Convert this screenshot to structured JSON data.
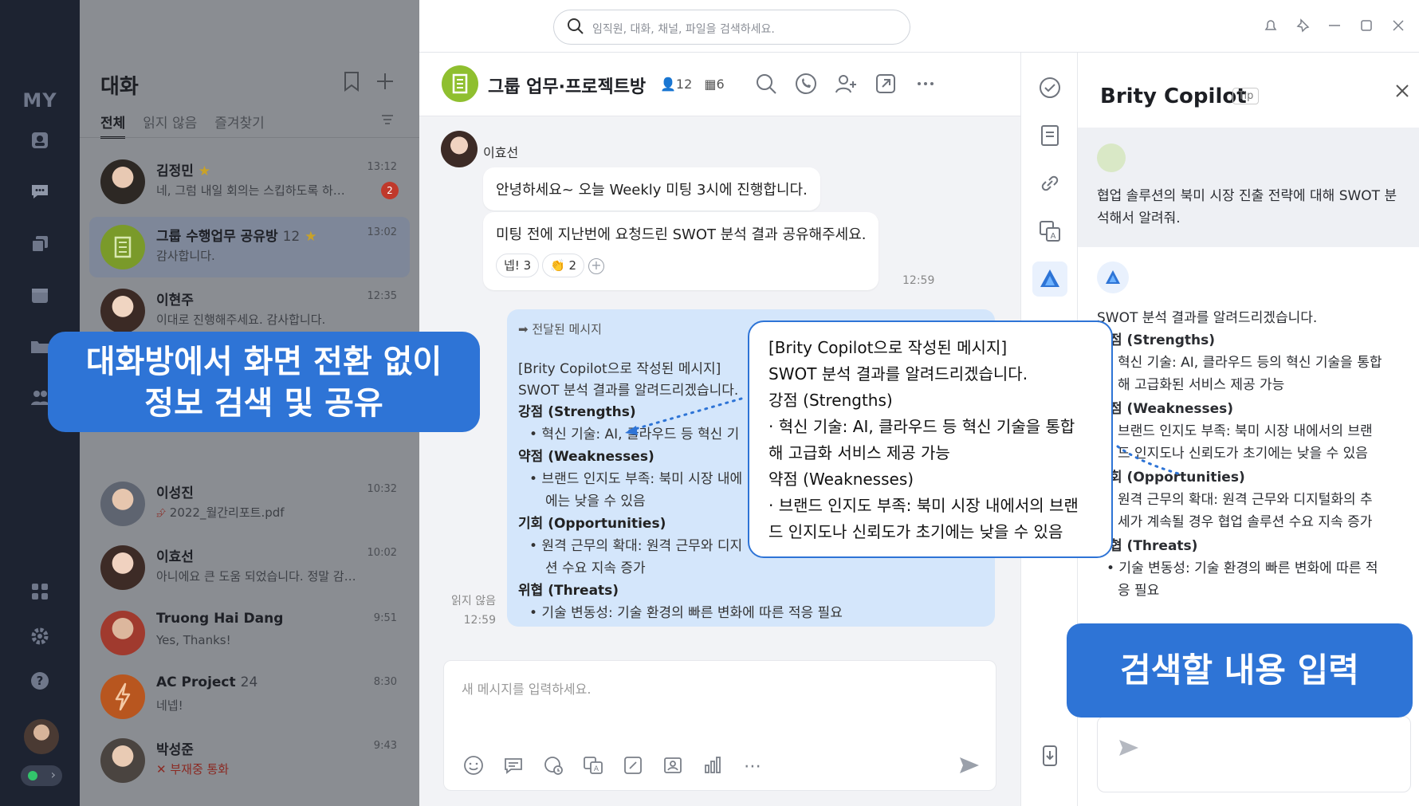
{
  "rail": {
    "my_label": "MY"
  },
  "convlist": {
    "title": "대화",
    "tabs": [
      "전체",
      "읽지 않음",
      "즐겨찾기"
    ],
    "items": [
      {
        "name": "김정민",
        "star": "★",
        "count": "",
        "preview": "네, 그럼 내일 회의는 스킵하도록 하…",
        "time": "13:12",
        "badge": "2"
      },
      {
        "name": "그룹 수행업무 공유방",
        "star": "★",
        "count": "12",
        "preview": "감사합니다.",
        "time": "13:02",
        "badge": ""
      },
      {
        "name": "이현주",
        "star": "",
        "count": "",
        "preview": "이대로 진행해주세요. 감사합니다.",
        "time": "12:35",
        "badge": ""
      },
      {
        "name": "이성진",
        "star": "",
        "count": "",
        "preview": "2022_월간리포트.pdf",
        "time": "10:32",
        "badge": ""
      },
      {
        "name": "이효선",
        "star": "",
        "count": "",
        "preview": "아니에요 큰 도움 되었습니다. 정말 감…",
        "time": "10:02",
        "badge": ""
      },
      {
        "name": "Truong Hai Dang",
        "star": "",
        "count": "",
        "preview": "Yes, Thanks!",
        "time": "9:51",
        "badge": ""
      },
      {
        "name": "AC Project",
        "star": "",
        "count": "24",
        "preview": "네넵!",
        "time": "8:30",
        "badge": ""
      },
      {
        "name": "박성준",
        "star": "",
        "count": "",
        "preview": "부재중 통화",
        "time": "9:43",
        "badge": ""
      }
    ]
  },
  "topbar": {
    "search_placeholder": "임직원, 대화, 채널, 파일을 검색하세요."
  },
  "chat": {
    "group_name": "그룹 업무·프로젝트방",
    "members": "12",
    "channels": "6",
    "sender": "이효선",
    "msg1": "안녕하세요~ 오늘 Weekly 미팅 3시에 진행합니다.",
    "msg2": "미팅 전에 지난번에 요청드린 SWOT 분석 결과 공유해주세요.",
    "react1": "넵! 3",
    "react2": "👏 2",
    "time1": "12:59",
    "fwd_header": "전달된 메시지",
    "fwd_lines": [
      "[Brity Copilot으로 작성된 메시지]",
      "SWOT 분석 결과를 알려드리겠습니다.",
      "강점 (Strengths)",
      "• 혁신 기술: AI, 클라우드 등 혁신 기",
      "약점 (Weaknesses)",
      "• 브랜드 인지도 부족: 북미 시장 내에",
      "에는 낮을 수 있음",
      "기회 (Opportunities)",
      "• 원격 근무의 확대: 원격 근무와 디지",
      "션 수요 지속 증가",
      "위협 (Threats)",
      "• 기술 변동성: 기술 환경의 빠른 변화에 따른 적응 필요"
    ],
    "unread_label": "읽지 않음",
    "time2": "12:59",
    "composer_placeholder": "새 메시지를 입력하세요."
  },
  "copilot": {
    "title": "Brity Copilot",
    "tip": "Tip",
    "question": "협업 솔루션의 북미 시장 진출 전략에 대해 SWOT 분석해서 알려줘.",
    "answer_lines": [
      "SWOT 분석 결과를 알려드리겠습니다.",
      "점 (Strengths)",
      "혁신 기술: AI, 클라우드 등의 혁신 기술을 통합",
      "해 고급화된 서비스 제공 가능",
      "점 (Weaknesses)",
      "브랜드 인지도 부족: 북미 시장 내에서의 브랜",
      "드 인지도나 신뢰도가 초기에는 낮을 수 있음",
      "회 (Opportunities)",
      "원격 근무의 확대: 원격 근무와 디지털화의 추",
      "세가 계속될 경우 협업 솔루션 수요 지속 증가",
      "협 (Threats)",
      "• 기술 변동성: 기술 환경의 빠른 변화에 따른 적",
      "응 필요"
    ]
  },
  "popup": {
    "lines": [
      "[Brity Copilot으로 작성된 메시지]",
      "SWOT 분석 결과를 알려드리겠습니다.",
      "강점 (Strengths)",
      "· 혁신 기술: AI, 클라우드 등 혁신 기술을 통합",
      "해 고급화 서비스 제공 가능",
      "약점 (Weaknesses)",
      "· 브랜드 인지도 부족: 북미 시장 내에서의 브랜",
      "드 인지도나 신뢰도가 초기에는 낮을 수 있음"
    ]
  },
  "callouts": {
    "left_line1": "대화방에서 화면 전환 없이",
    "left_line2": "정보 검색 및 공유",
    "right": "검색할 내용 입력"
  },
  "colors": {
    "accent": "#2e74d6",
    "highlight_bubble": "#d4e6fb",
    "rail": "#1d2331"
  }
}
